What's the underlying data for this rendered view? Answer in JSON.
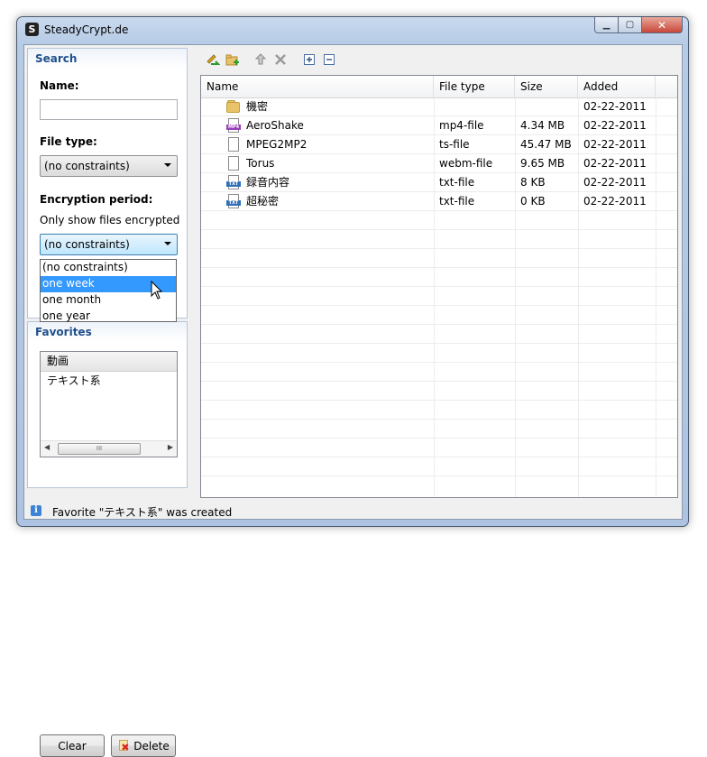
{
  "window": {
    "title": "SteadyCrypt.de",
    "app_icon_letter": "S"
  },
  "search": {
    "title": "Search",
    "name_label": "Name:",
    "name_value": "",
    "file_type_label": "File type:",
    "file_type_value": "(no constraints)",
    "encryption_label": "Encryption period:",
    "encryption_hint": "Only show files encrypted",
    "encryption_value": "(no constraints)",
    "encryption_options": [
      "(no constraints)",
      "one week",
      "one month",
      "one year"
    ],
    "encryption_hovered": "one week"
  },
  "favorites": {
    "title": "Favorites",
    "items": [
      "動画",
      "テキスト系"
    ],
    "selected": "動画",
    "clear_label": "Clear",
    "delete_label": "Delete"
  },
  "files": {
    "columns": [
      "Name",
      "File type",
      "Size",
      "Added"
    ],
    "rows": [
      {
        "name": "機密",
        "type": "",
        "size": "",
        "added": "02-22-2011",
        "icon": "folder-icon"
      },
      {
        "name": "AeroShake",
        "type": "mp4-file",
        "size": "4.34 MB",
        "added": "02-22-2011",
        "icon": "mp4-file-icon"
      },
      {
        "name": "MPEG2MP2",
        "type": "ts-file",
        "size": "45.47 MB",
        "added": "02-22-2011",
        "icon": "blank-file-icon"
      },
      {
        "name": "Torus",
        "type": "webm-file",
        "size": "9.65 MB",
        "added": "02-22-2011",
        "icon": "blank-file-icon"
      },
      {
        "name": "録音内容",
        "type": "txt-file",
        "size": "8 KB",
        "added": "02-22-2011",
        "icon": "txt-file-icon"
      },
      {
        "name": "超秘密",
        "type": "txt-file",
        "size": "0 KB",
        "added": "02-22-2011",
        "icon": "txt-file-icon"
      }
    ]
  },
  "icon_badges": {
    "mp4": "MP4",
    "txt": "TXT"
  },
  "status": {
    "text": "Favorite \"テキスト系\" was created"
  },
  "colors": {
    "accent": "#1f4f8c",
    "selection": "#3399ff",
    "folder": "#e8c36a"
  }
}
